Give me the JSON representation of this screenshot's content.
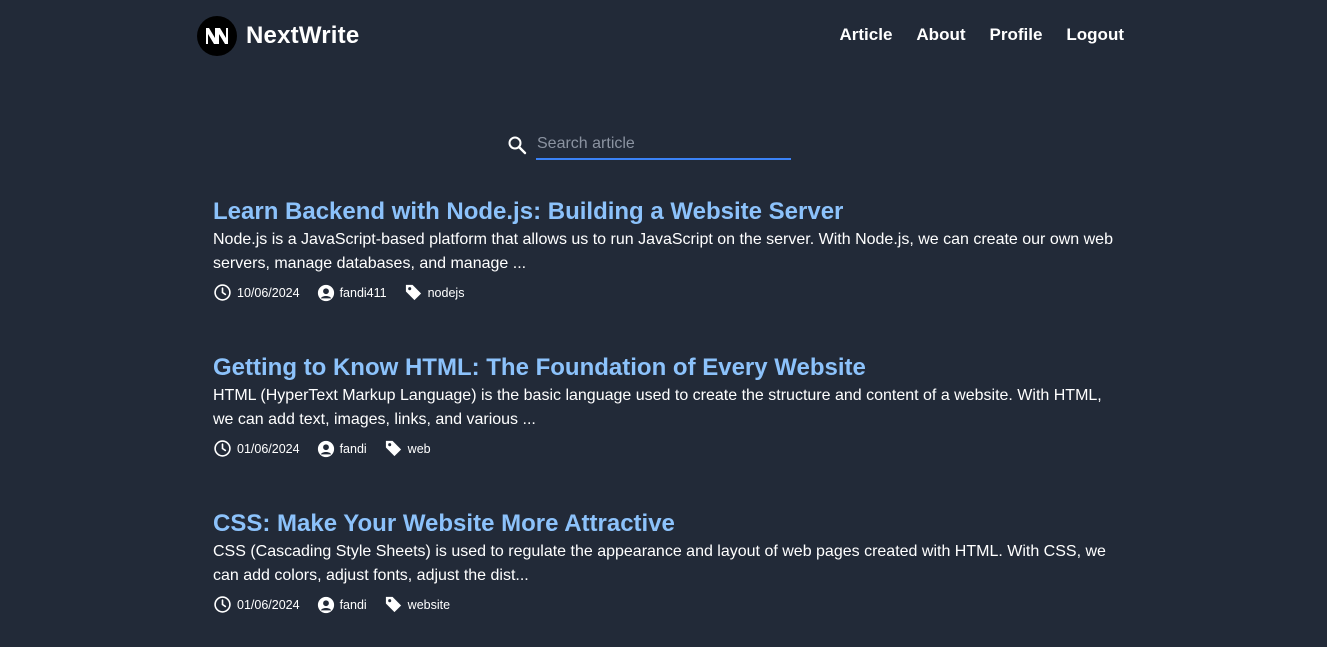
{
  "header": {
    "brand": "NextWrite",
    "nav": [
      {
        "label": "Article"
      },
      {
        "label": "About"
      },
      {
        "label": "Profile"
      },
      {
        "label": "Logout"
      }
    ]
  },
  "search": {
    "placeholder": "Search article",
    "value": ""
  },
  "articles": [
    {
      "title": "Learn Backend with Node.js: Building a Website Server",
      "excerpt": "Node.js is a JavaScript-based platform that allows us to run JavaScript on the server. With Node.js, we can create our own web servers, manage databases, and manage ...",
      "date": "10/06/2024",
      "author": "fandi411",
      "tag": "nodejs"
    },
    {
      "title": "Getting to Know HTML: The Foundation of Every Website",
      "excerpt": "HTML (HyperText Markup Language) is the basic language used to create the structure and content of a website. With HTML, we can add text, images, links, and various ...",
      "date": "01/06/2024",
      "author": "fandi",
      "tag": "web"
    },
    {
      "title": "CSS: Make Your Website More Attractive",
      "excerpt": "CSS (Cascading Style Sheets) is used to regulate the appearance and layout of web pages created with HTML. With CSS, we can add colors, adjust fonts, adjust the dist...",
      "date": "01/06/2024",
      "author": "fandi",
      "tag": "website"
    }
  ],
  "icons": {
    "logo": "nextwrite-logo-icon",
    "search": "search-icon",
    "date": "clock-icon",
    "author": "user-circle-icon",
    "tag": "tag-icon"
  },
  "colors": {
    "background": "#222a38",
    "title_link": "#8cc2fb",
    "search_underline": "#3b82f6"
  }
}
